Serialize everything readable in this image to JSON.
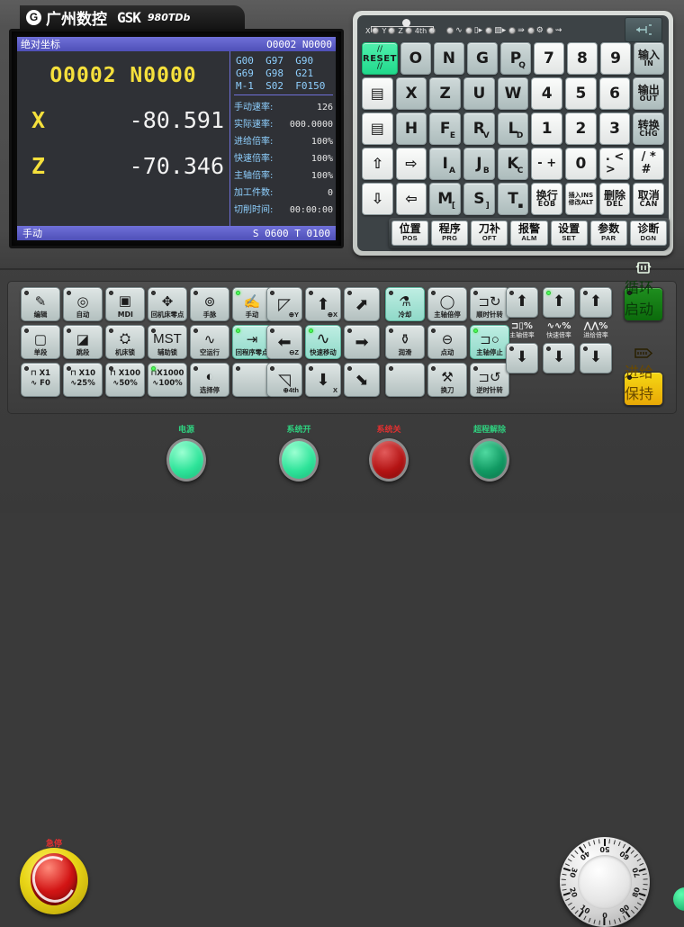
{
  "brand": {
    "logo_mark": "G",
    "name_cn": "广州数控",
    "name_en": "GSK",
    "model": "980TDb"
  },
  "lcd": {
    "titlebar_left": "绝对坐标",
    "titlebar_right": "O0002  N0000",
    "program_line": "O0002 N0000",
    "axes": [
      {
        "name": "X",
        "value": "-80.591"
      },
      {
        "name": "Z",
        "value": "-70.346"
      }
    ],
    "gcode_lines": [
      "G00  G97  G90",
      "G69  G98  G21",
      "M-1  S02  F0150"
    ],
    "params": [
      {
        "label": "手动速率:",
        "value": "126"
      },
      {
        "label": "实际速率:",
        "value": "000.0000"
      },
      {
        "label": "进给倍率:",
        "value": "100%"
      },
      {
        "label": "快速倍率:",
        "value": "100%"
      },
      {
        "label": "主轴倍率:",
        "value": "100%"
      },
      {
        "label": "加工件数:",
        "value": "0"
      },
      {
        "label": "切削时间:",
        "value": "00:00:00"
      }
    ],
    "statusbar_left": "手动",
    "statusbar_right": "S 0600  T 0100"
  },
  "indicators": {
    "axis_leds": [
      "X",
      "Y",
      "Z",
      "4th"
    ],
    "function_leds": [
      "spindle-wave-icon",
      "chuck-icon",
      "tailstock-icon",
      "rapid-arrow-icon",
      "coolant-icon",
      "lube-icon"
    ]
  },
  "keypad": {
    "rows": [
      [
        {
          "name": "reset-key",
          "style": "green",
          "main": "RESET",
          "kind": "reset"
        },
        {
          "name": "key-o",
          "style": "gray",
          "main": "O"
        },
        {
          "name": "key-n",
          "style": "gray",
          "main": "N"
        },
        {
          "name": "key-g",
          "style": "gray",
          "main": "G"
        },
        {
          "name": "key-p-q",
          "style": "gray",
          "main": "P",
          "sup": "Q"
        },
        {
          "name": "key-7",
          "style": "white",
          "main": "7"
        },
        {
          "name": "key-8",
          "style": "white",
          "main": "8"
        },
        {
          "name": "key-9",
          "style": "white",
          "main": "9"
        },
        {
          "name": "input-key",
          "style": "gray",
          "cn": "输入",
          "sub": "IN"
        }
      ],
      [
        {
          "name": "page-up-key",
          "style": "white",
          "glyph": "▤"
        },
        {
          "name": "key-x",
          "style": "gray",
          "main": "X"
        },
        {
          "name": "key-z",
          "style": "gray",
          "main": "Z"
        },
        {
          "name": "key-u",
          "style": "gray",
          "main": "U"
        },
        {
          "name": "key-w",
          "style": "gray",
          "main": "W"
        },
        {
          "name": "key-4",
          "style": "white",
          "main": "4"
        },
        {
          "name": "key-5",
          "style": "white",
          "main": "5"
        },
        {
          "name": "key-6",
          "style": "white",
          "main": "6"
        },
        {
          "name": "output-key",
          "style": "gray",
          "cn": "输出",
          "sub": "OUT"
        }
      ],
      [
        {
          "name": "page-down-key",
          "style": "white",
          "glyph": "▤"
        },
        {
          "name": "key-h",
          "style": "gray",
          "main": "H"
        },
        {
          "name": "key-f-e",
          "style": "gray",
          "main": "F",
          "sup": "E"
        },
        {
          "name": "key-r-v",
          "style": "gray",
          "main": "R",
          "sup": "V"
        },
        {
          "name": "key-l-d",
          "style": "gray",
          "main": "L",
          "sup": "D"
        },
        {
          "name": "key-1",
          "style": "white",
          "main": "1"
        },
        {
          "name": "key-2",
          "style": "white",
          "main": "2"
        },
        {
          "name": "key-3",
          "style": "white",
          "main": "3"
        },
        {
          "name": "change-key",
          "style": "gray",
          "cn": "转换",
          "sub": "CHG"
        }
      ],
      [
        {
          "name": "cursor-up-key",
          "style": "white",
          "glyph": "⇧"
        },
        {
          "name": "cursor-right-key",
          "style": "white",
          "glyph": "⇨"
        },
        {
          "name": "key-i-a",
          "style": "gray",
          "main": "I",
          "sup": "A"
        },
        {
          "name": "key-j-b",
          "style": "gray",
          "main": "J",
          "sup": "B"
        },
        {
          "name": "key-k-c",
          "style": "gray",
          "main": "K",
          "sup": "C"
        },
        {
          "name": "key-minus-plus",
          "style": "white",
          "sym": "-  +"
        },
        {
          "name": "key-0",
          "style": "white",
          "main": "0"
        },
        {
          "name": "key-gt-lt",
          "style": "white",
          "sym": ". <\n>"
        },
        {
          "name": "key-slash-hash",
          "style": "white",
          "sym": "/ *\n#"
        }
      ],
      [
        {
          "name": "cursor-down-key",
          "style": "white",
          "glyph": "⇩"
        },
        {
          "name": "cursor-left-key",
          "style": "white",
          "glyph": "⇦"
        },
        {
          "name": "key-m-bracket",
          "style": "gray",
          "main": "M",
          "sup": "["
        },
        {
          "name": "key-s-bracket",
          "style": "gray",
          "main": "S",
          "sup": "]"
        },
        {
          "name": "key-t-dot",
          "style": "gray",
          "main": "T",
          "sup": "▪"
        },
        {
          "name": "eob-key",
          "style": "white",
          "cn": "换行",
          "sub": "EOB"
        },
        {
          "name": "insert-alter-key",
          "style": "white",
          "twoline_a": "插入INS",
          "twoline_b": "修改ALT"
        },
        {
          "name": "delete-key",
          "style": "white",
          "cn": "删除",
          "sub": "DEL"
        },
        {
          "name": "cancel-key",
          "style": "white",
          "cn": "取消",
          "sub": "CAN"
        }
      ]
    ]
  },
  "softkeys": [
    {
      "name": "position-key",
      "cn": "位置",
      "en": "POS"
    },
    {
      "name": "program-key",
      "cn": "程序",
      "en": "PRG"
    },
    {
      "name": "offset-key",
      "cn": "刀补",
      "en": "OFT"
    },
    {
      "name": "alarm-key",
      "cn": "报警",
      "en": "ALM"
    },
    {
      "name": "setting-key",
      "cn": "设置",
      "en": "SET"
    },
    {
      "name": "parameter-key",
      "cn": "参数",
      "en": "PAR"
    },
    {
      "name": "diagnosis-key",
      "cn": "诊断",
      "en": "DGN"
    }
  ],
  "mode_buttons": {
    "row1": [
      {
        "name": "mode-edit-button",
        "label": "编辑",
        "glyph": "✎",
        "lamp": false,
        "active": false
      },
      {
        "name": "mode-auto-button",
        "label": "自动",
        "glyph": "◎",
        "lamp": false,
        "active": false
      },
      {
        "name": "mode-mdi-button",
        "label": "MDI",
        "glyph": "▣",
        "lamp": false,
        "active": false,
        "en": true
      },
      {
        "name": "machine-zero-button",
        "label": "回机床零点",
        "glyph": "✥",
        "lamp": false,
        "active": false
      },
      {
        "name": "handwheel-button",
        "label": "手脉",
        "glyph": "⊚",
        "lamp": false,
        "active": false
      },
      {
        "name": "manual-button",
        "label": "手动",
        "glyph": "✍",
        "lamp": true,
        "active": false
      }
    ],
    "row2": [
      {
        "name": "single-block-button",
        "label": "单段",
        "glyph": "▢",
        "lamp": false,
        "active": false
      },
      {
        "name": "block-skip-button",
        "label": "跳段",
        "glyph": "◪",
        "lamp": false,
        "active": false
      },
      {
        "name": "machine-lock-button",
        "label": "机床锁",
        "glyph": "⛭",
        "lamp": false,
        "active": false
      },
      {
        "name": "aux-lock-button",
        "label": "辅助锁",
        "glyph": "MST",
        "lamp": false,
        "active": false
      },
      {
        "name": "dry-run-button",
        "label": "空运行",
        "glyph": "∿",
        "lamp": false,
        "active": false
      },
      {
        "name": "program-zero-button",
        "label": "回程序零点",
        "glyph": "⇥",
        "lamp": true,
        "active": true
      }
    ],
    "row3": [
      {
        "name": "step-x1-button",
        "top": "⊓ X1",
        "bottom": "∿ F0",
        "lamp": false,
        "active": false
      },
      {
        "name": "step-x10-button",
        "top": "⊓ X10",
        "bottom": "∿25%",
        "lamp": false,
        "active": false
      },
      {
        "name": "step-x100-button",
        "top": "⊓ X100",
        "bottom": "∿50%",
        "lamp": false,
        "active": false
      },
      {
        "name": "step-x1000-button",
        "top": "⊓X1000",
        "bottom": "∿100%",
        "lamp": true,
        "active": false
      },
      {
        "name": "optional-stop-button",
        "label": "选择停",
        "glyph": "◐",
        "lamp": false,
        "active": false
      },
      {
        "name": "blank-button",
        "label": "",
        "glyph": "",
        "lamp": false,
        "active": false
      }
    ]
  },
  "jogpad": [
    {
      "name": "jog-y-plus-button",
      "glyph": "◸",
      "axis": "⊕Y",
      "lamp": false,
      "active": false
    },
    {
      "name": "jog-x-plus-button",
      "glyph": "⬆",
      "axis": "⊕X",
      "lamp": false,
      "active": false
    },
    {
      "name": "jog-diag-ne-button",
      "glyph": "⬈",
      "axis": "",
      "lamp": false,
      "active": false
    },
    {
      "name": "jog-z-minus-button",
      "glyph": "⬅",
      "axis": "⊖Z",
      "lamp": false,
      "active": false
    },
    {
      "name": "rapid-traverse-button",
      "label": "快速移动",
      "glyph": "∿",
      "lamp": true,
      "active": true
    },
    {
      "name": "jog-z-plus-button",
      "glyph": "➡",
      "axis": "",
      "lamp": false,
      "active": false
    },
    {
      "name": "jog-4th-button",
      "glyph": "◹",
      "axis": "⊕4th",
      "lamp": false,
      "active": false
    },
    {
      "name": "jog-x-minus-button",
      "glyph": "⬇",
      "axis": "X",
      "lamp": false,
      "active": false
    },
    {
      "name": "jog-diag-se-button",
      "glyph": "⬊",
      "axis": "",
      "lamp": false,
      "active": false
    }
  ],
  "spindle_buttons": [
    {
      "name": "coolant-button",
      "label": "冷却",
      "glyph": "⚗",
      "lamp": false,
      "active": true
    },
    {
      "name": "spindle-jog-button",
      "label": "主轴倍停",
      "glyph": "◯",
      "lamp": false,
      "active": false
    },
    {
      "name": "spindle-cw-button",
      "label": "顺时针转",
      "glyph": "⊐↻",
      "lamp": false,
      "active": false
    },
    {
      "name": "lubrication-button",
      "label": "润滑",
      "glyph": "⚱",
      "lamp": false,
      "active": false
    },
    {
      "name": "jog-button",
      "label": "点动",
      "glyph": "⊖",
      "lamp": false,
      "active": false
    },
    {
      "name": "spindle-stop-button",
      "label": "主轴停止",
      "glyph": "⊐○",
      "lamp": true,
      "active": true
    },
    {
      "name": "blank2-button",
      "label": "",
      "glyph": "",
      "lamp": false,
      "active": false
    },
    {
      "name": "tool-change-button",
      "label": "换刀",
      "glyph": "⚒",
      "lamp": false,
      "active": false
    },
    {
      "name": "spindle-ccw-button",
      "label": "逆时针转",
      "glyph": "⊐↺",
      "lamp": false,
      "active": false
    }
  ],
  "override": {
    "up_buttons": [
      {
        "name": "spindle-override-up-button",
        "glyph": "⬆",
        "sign": "+",
        "lamp": false
      },
      {
        "name": "rapid-override-up-button",
        "glyph": "⬆",
        "sign": "+",
        "lamp": true
      },
      {
        "name": "feed-override-up-button",
        "glyph": "⬆",
        "sign": "+",
        "lamp": false
      }
    ],
    "legend": [
      {
        "name": "spindle-override-legend",
        "sym": "⊐▯%",
        "label": "主轴倍率"
      },
      {
        "name": "rapid-override-legend",
        "sym": "∿∿%",
        "label": "快速倍率"
      },
      {
        "name": "feed-override-legend",
        "sym": "⋀⋀%",
        "label": "进给倍率"
      }
    ],
    "down_buttons": [
      {
        "name": "spindle-override-down-button",
        "glyph": "⬇",
        "sign": "-",
        "lamp": false
      },
      {
        "name": "rapid-override-down-button",
        "glyph": "⬇",
        "sign": "-",
        "lamp": false
      },
      {
        "name": "feed-override-down-button",
        "glyph": "⬇",
        "sign": "-",
        "lamp": false
      }
    ]
  },
  "cycle_start": {
    "name": "cycle-start-button",
    "label": "循环启动",
    "glyph": "⎋",
    "color": "#167a16"
  },
  "feed_hold": {
    "name": "feed-hold-button",
    "label": "进给保持",
    "glyph": "⊐",
    "color": "#f0c40a"
  },
  "bottom_controls": {
    "estop": {
      "label": "急停",
      "color": "#e03030"
    },
    "lamps": [
      {
        "name": "power-button",
        "label": "电源",
        "color": "#2fe49a",
        "style": "green-light",
        "label_color": "#2fd07f"
      },
      {
        "name": "system-on-button",
        "label": "系统开",
        "color": "#2fe49a",
        "style": "green-light",
        "label_color": "#2fd07f"
      },
      {
        "name": "system-off-button",
        "label": "系统关",
        "color": "#b41414",
        "style": "red",
        "label_color": "#e03030"
      },
      {
        "name": "overtravel-release-button",
        "label": "超程解除",
        "color": "#119a63",
        "style": "green-dark",
        "label_color": "#2fd07f"
      }
    ]
  },
  "dial": {
    "name": "feed-override-dial",
    "ticks": [
      "0",
      "10",
      "20",
      "30",
      "40",
      "50",
      "60",
      "70",
      "80",
      "90"
    ]
  }
}
